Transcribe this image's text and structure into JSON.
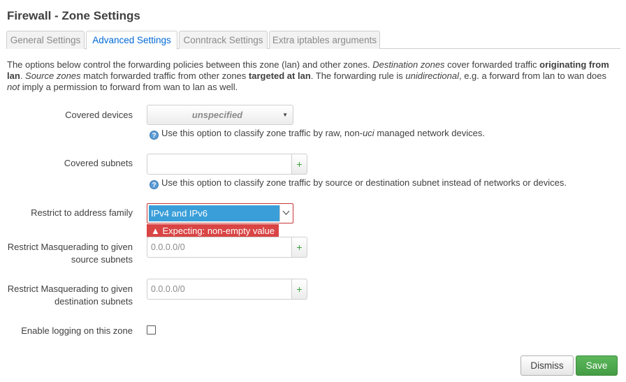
{
  "title": "Firewall - Zone Settings",
  "tabs": [
    {
      "label": "General Settings",
      "active": false
    },
    {
      "label": "Advanced Settings",
      "active": true
    },
    {
      "label": "Conntrack Settings",
      "active": false
    },
    {
      "label": "Extra iptables arguments",
      "active": false
    }
  ],
  "description": {
    "p1": "The options below control the forwarding policies between this zone (lan) and other zones. ",
    "p2_em": "Destination zones",
    "p3": " cover forwarded traffic ",
    "p4_strong": "originating from lan",
    "p5": ". ",
    "p6_em": "Source zones",
    "p7": " match forwarded traffic from other zones ",
    "p8_strong": "targeted at lan",
    "p9": ". The forwarding rule is ",
    "p10_em": "unidirectional",
    "p11": ", e.g. a forward from lan to wan does ",
    "p12_em": "not",
    "p13": " imply a permission to forward from wan to lan as well."
  },
  "covered_devices": {
    "label": "Covered devices",
    "value": "unspecified",
    "hint_a": "Use this option to classify zone traffic by raw, non-",
    "hint_em": "uci",
    "hint_b": " managed network devices."
  },
  "covered_subnets": {
    "label": "Covered subnets",
    "value": "",
    "hint": "Use this option to classify zone traffic by source or destination subnet instead of networks or devices."
  },
  "address_family": {
    "label": "Restrict to address family",
    "value": "IPv4 and IPv6",
    "error": "Expecting: non-empty value"
  },
  "masq_src": {
    "label_line1": "Restrict Masquerading to given",
    "label_line2": "source subnets",
    "placeholder": "0.0.0.0/0"
  },
  "masq_dest": {
    "label_line1": "Restrict Masquerading to given",
    "label_line2": "destination subnets",
    "placeholder": "0.0.0.0/0"
  },
  "logging": {
    "label": "Enable logging on this zone",
    "checked": false
  },
  "icons": {
    "help": "help-icon",
    "plus": "plus-icon",
    "dropdown": "chevron-down-icon",
    "warning": "warning-icon"
  },
  "buttons": {
    "dismiss": "Dismiss",
    "save": "Save"
  },
  "colors": {
    "accent": "#0069d6",
    "save": "#5cb85c",
    "error": "#d94545",
    "selected": "#3a9ed8"
  }
}
